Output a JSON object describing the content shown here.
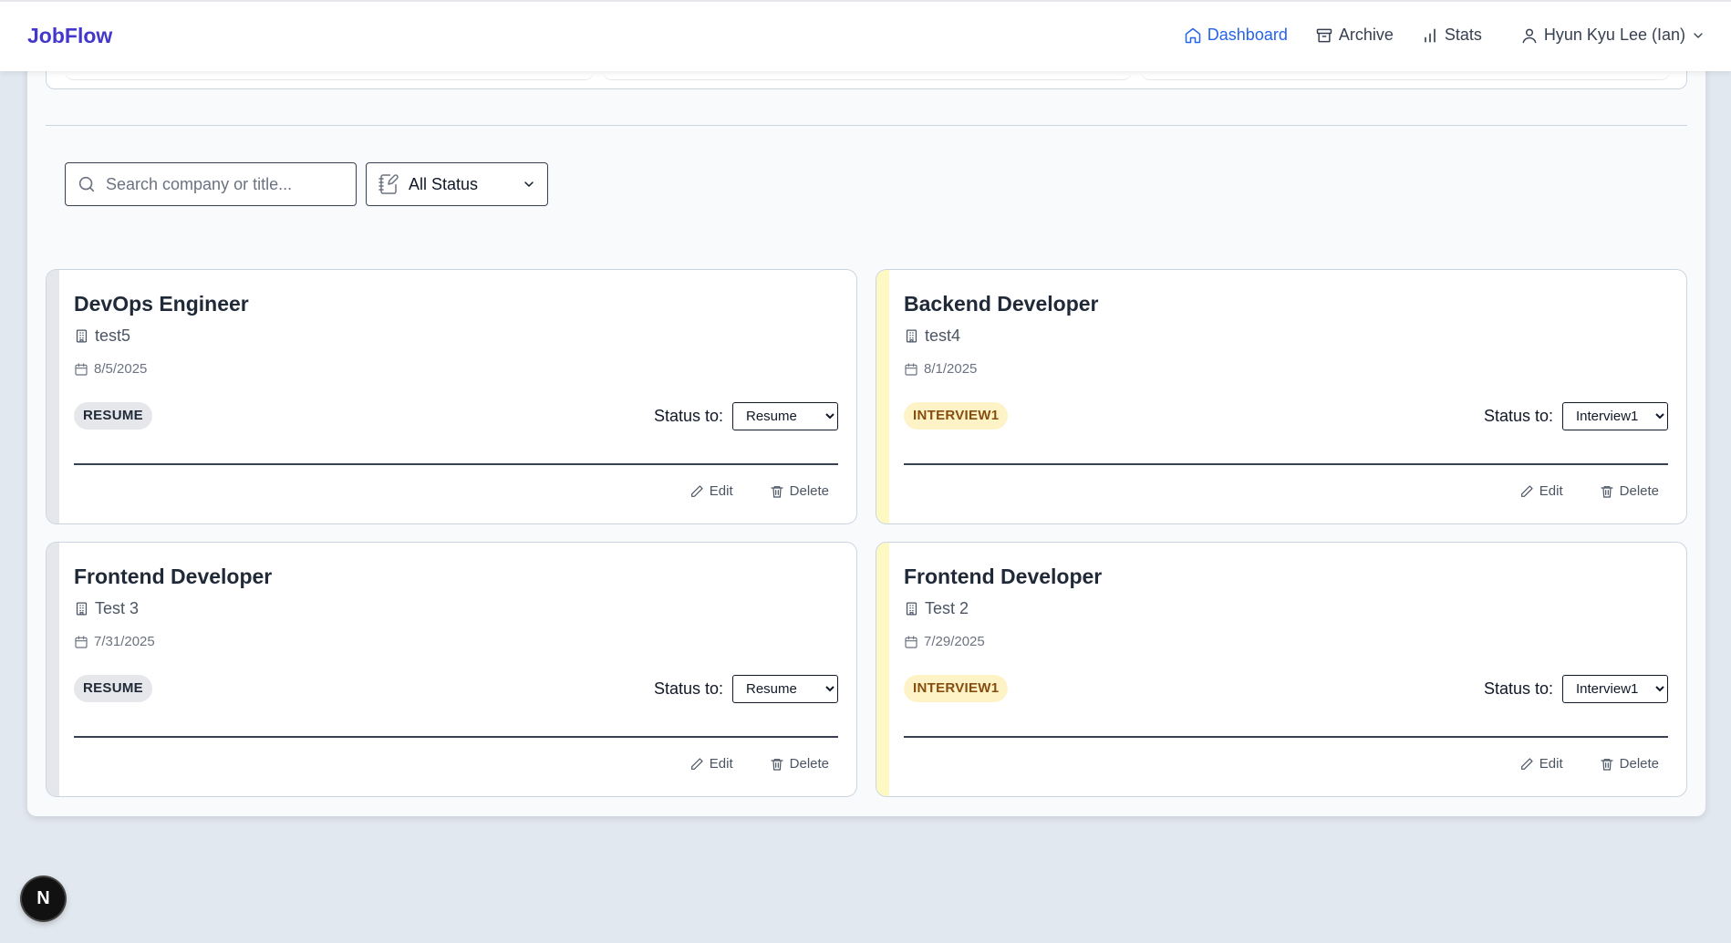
{
  "header": {
    "brand": "JobFlow",
    "nav": {
      "dashboard": "Dashboard",
      "archive": "Archive",
      "stats": "Stats",
      "user": "Hyun Kyu Lee (Ian)"
    }
  },
  "filters": {
    "search_placeholder": "Search company or title...",
    "status_selected": "All Status"
  },
  "cards": [
    {
      "title": "DevOps Engineer",
      "company": "test5",
      "date": "8/5/2025",
      "badge": "RESUME",
      "status_label": "Status to:",
      "status_value": "Resume",
      "edit": "Edit",
      "delete": "Delete"
    },
    {
      "title": "Backend Developer",
      "company": "test4",
      "date": "8/1/2025",
      "badge": "INTERVIEW1",
      "status_label": "Status to:",
      "status_value": "Interview1",
      "edit": "Edit",
      "delete": "Delete"
    },
    {
      "title": "Frontend Developer",
      "company": "Test 3",
      "date": "7/31/2025",
      "badge": "RESUME",
      "status_label": "Status to:",
      "status_value": "Resume",
      "edit": "Edit",
      "delete": "Delete"
    },
    {
      "title": "Frontend Developer",
      "company": "Test 2",
      "date": "7/29/2025",
      "badge": "INTERVIEW1",
      "status_label": "Status to:",
      "status_value": "Interview1",
      "edit": "Edit",
      "delete": "Delete"
    }
  ],
  "dev_indicator": "N",
  "colors": {
    "brand": "#4338ca",
    "active_nav": "#2563eb",
    "interview_badge_bg": "#fef3c7",
    "interview_badge_text": "#854d0e",
    "resume_badge_bg": "#e5e7eb"
  }
}
